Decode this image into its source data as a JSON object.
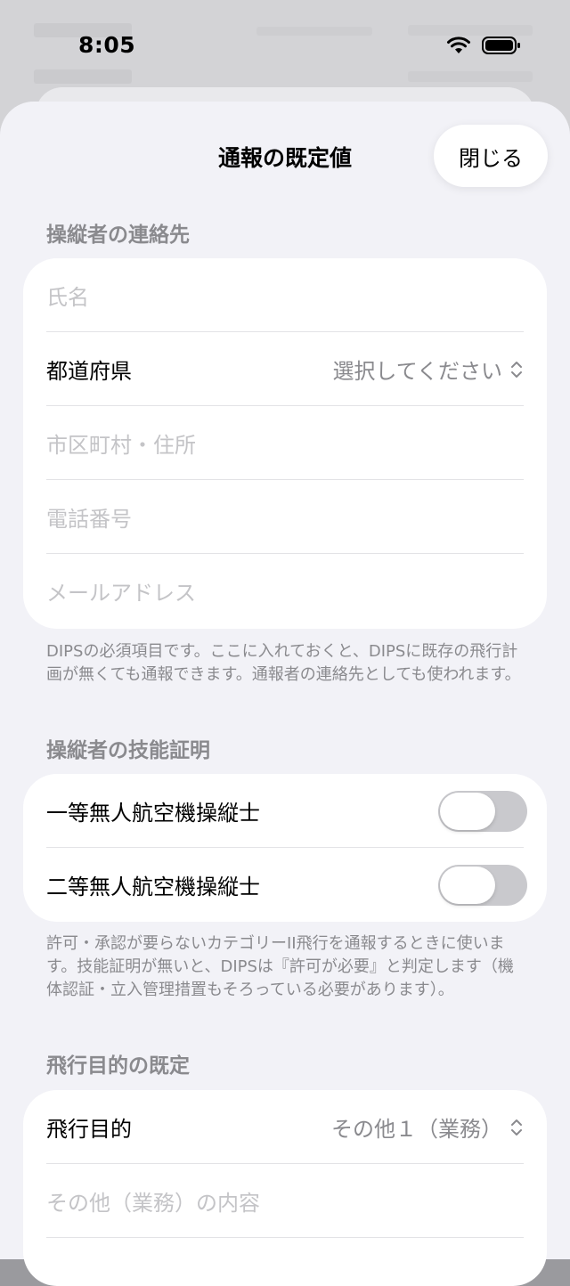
{
  "status_bar": {
    "time": "8:05"
  },
  "sheet": {
    "title": "通報の既定値",
    "close_label": "閉じる"
  },
  "operator_contact": {
    "header": "操縦者の連絡先",
    "name_placeholder": "氏名",
    "prefecture_label": "都道府県",
    "prefecture_value": "選択してください",
    "address_placeholder": "市区町村・住所",
    "phone_placeholder": "電話番号",
    "email_placeholder": "メールアドレス",
    "footnote": "DIPSの必須項目です。ここに入れておくと、DIPSに既存の飛行計画が無くても通報できます。通報者の連絡先としても使われます。"
  },
  "operator_license": {
    "header": "操縦者の技能証明",
    "first_class_label": "一等無人航空機操縦士",
    "first_class_on": false,
    "second_class_label": "二等無人航空機操縦士",
    "second_class_on": false,
    "footnote": "許可・承認が要らないカテゴリーII飛行を通報するときに使います。技能証明が無いと、DIPSは『許可が必要』と判定します（機体認証・立入管理措置もそろっている必要があります）。"
  },
  "flight_purpose": {
    "header": "飛行目的の既定",
    "purpose_label": "飛行目的",
    "purpose_value": "その他１（業務）",
    "other_detail_placeholder": "その他（業務）の内容"
  }
}
